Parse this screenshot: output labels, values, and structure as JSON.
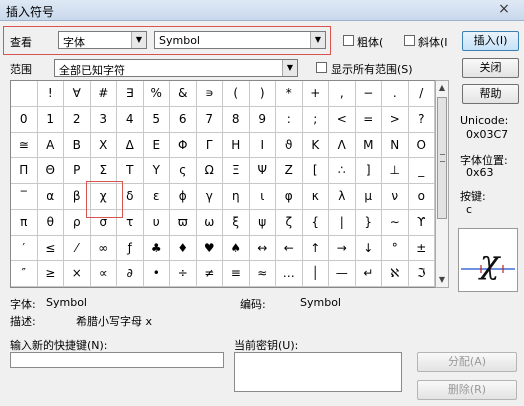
{
  "window": {
    "title": "插入符号",
    "close": "×"
  },
  "top": {
    "view_label": "查看",
    "filter_value": "字体",
    "font_value": "Symbol",
    "bold_label": "粗体(",
    "italic_label": "斜体(I",
    "insert_button": "插入(I)"
  },
  "range": {
    "label": "范围",
    "value": "全部已知字符",
    "show_all_label": "显示所有范围(S)",
    "close_button": "关闭",
    "help_button": "帮助"
  },
  "info": {
    "unicode_label": "Unicode:",
    "unicode_value": "0x03C7",
    "position_label": "字体位置:",
    "position_value": "0x63",
    "key_label": "按键:",
    "key_value": "c"
  },
  "grid": {
    "rows": [
      [
        "",
        "!",
        "∀",
        "#",
        "∃",
        "%",
        "&",
        "∍",
        "(",
        ")",
        "*",
        "+",
        ",",
        "−",
        ".",
        "/"
      ],
      [
        "0",
        "1",
        "2",
        "3",
        "4",
        "5",
        "6",
        "7",
        "8",
        "9",
        ":",
        ";",
        "<",
        "=",
        ">",
        "?"
      ],
      [
        "≅",
        "Α",
        "Β",
        "Χ",
        "Δ",
        "Ε",
        "Φ",
        "Γ",
        "Η",
        "Ι",
        "ϑ",
        "Κ",
        "Λ",
        "Μ",
        "Ν",
        "Ο"
      ],
      [
        "Π",
        "Θ",
        "Ρ",
        "Σ",
        "Τ",
        "Υ",
        "ς",
        "Ω",
        "Ξ",
        "Ψ",
        "Ζ",
        "[",
        "∴",
        "]",
        "⊥",
        "_"
      ],
      [
        "‾",
        "α",
        "β",
        "χ",
        "δ",
        "ε",
        "ϕ",
        "γ",
        "η",
        "ι",
        "φ",
        "κ",
        "λ",
        "μ",
        "ν",
        "ο"
      ],
      [
        "π",
        "θ",
        "ρ",
        "σ",
        "τ",
        "υ",
        "ϖ",
        "ω",
        "ξ",
        "ψ",
        "ζ",
        "{",
        "|",
        "}",
        "∼",
        "ϒ"
      ],
      [
        "′",
        "≤",
        "⁄",
        "∞",
        "ƒ",
        "♣",
        "♦",
        "♥",
        "♠",
        "↔",
        "←",
        "↑",
        "→",
        "↓",
        "°",
        "±"
      ],
      [
        "″",
        "≥",
        "×",
        "∝",
        "∂",
        "•",
        "÷",
        "≠",
        "≡",
        "≈",
        "…",
        "│",
        "—",
        "↵",
        "ℵ",
        "ℑ"
      ]
    ]
  },
  "details": {
    "font_label": "字体:",
    "font_value": "Symbol",
    "code_label": "编码:",
    "code_value": "Symbol",
    "desc_label": "描述:",
    "desc_value": "希腊小写字母 x"
  },
  "shortcut": {
    "new_key_label": "输入新的快捷键(N):",
    "current_key_label": "当前密钥(U):",
    "assign_button": "分配(A)",
    "remove_button": "删除(R)"
  },
  "colors": {
    "selection_box": "#d9534f",
    "preview_line": "#1a4fd0",
    "preview_marker": "#c02020"
  }
}
